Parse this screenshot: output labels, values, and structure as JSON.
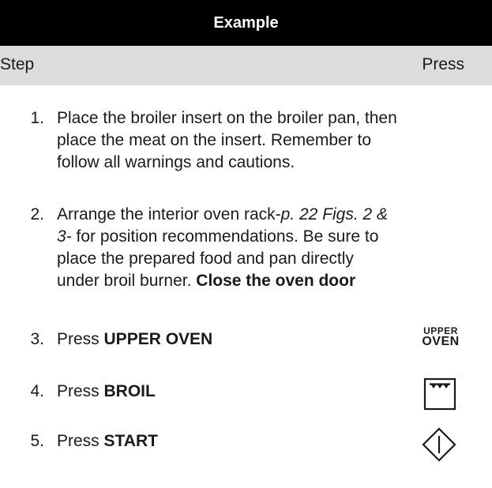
{
  "header": {
    "title": "Example",
    "col_step": "Step",
    "col_press": "Press"
  },
  "steps": [
    {
      "num": "1.",
      "lines": [
        "Place the broiler insert on the broiler pan, then",
        "place the meat on the insert. Remember to",
        "follow all warnings and cautions."
      ]
    },
    {
      "num": "2.",
      "line1_a": "Arrange the interior oven rack-",
      "line1_ref": "p. 22 Figs. 2 &",
      "line2_ref": "3-",
      "line2_b": " for position recommendations. Be sure to",
      "line3": "place the prepared food and pan directly",
      "line4_a": "under broil burner. ",
      "line4_bold": "Close the oven door"
    },
    {
      "num": "3.",
      "prefix": "Press ",
      "key": "UPPER OVEN",
      "icon": "upper-oven-key-icon",
      "icon_small": "UPPER",
      "icon_big": "OVEN"
    },
    {
      "num": "4.",
      "prefix": "Press ",
      "key": "BROIL",
      "icon": "broil-key-icon"
    },
    {
      "num": "5.",
      "prefix": "Press ",
      "key": "START",
      "icon": "start-key-icon"
    }
  ]
}
